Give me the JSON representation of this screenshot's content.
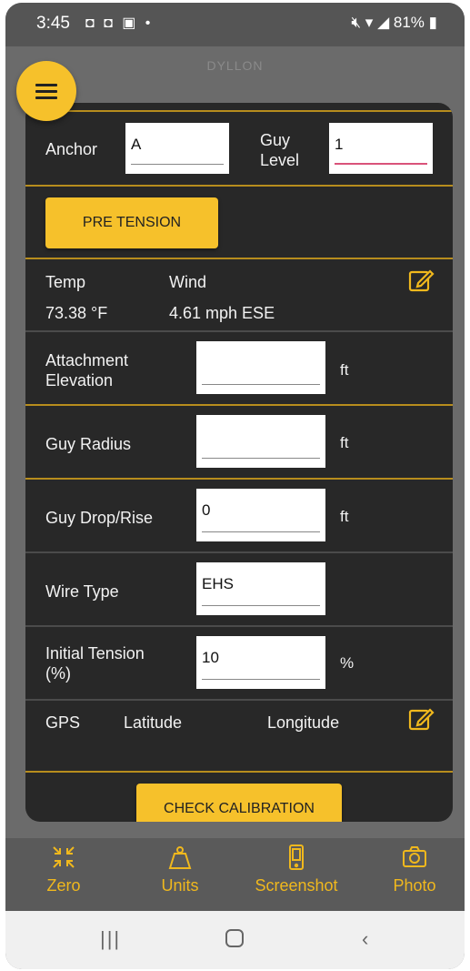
{
  "status_bar": {
    "time": "3:45",
    "notif_icons": "◘ ◘ ▣ •",
    "battery": "81%"
  },
  "app": {
    "title": "DYLLON"
  },
  "form": {
    "anchor_label": "Anchor",
    "anchor_value": "A",
    "guy_level_label_1": "Guy",
    "guy_level_label_2": "Level",
    "guy_level_value": "1",
    "pretension_button": "PRE TENSION",
    "temp_label": "Temp",
    "temp_value": "73.38 °F",
    "wind_label": "Wind",
    "wind_value": "4.61 mph  ESE",
    "attach_label_1": "Attachment",
    "attach_label_2": "Elevation",
    "attach_value": "",
    "attach_unit": "ft",
    "guy_radius_label": "Guy Radius",
    "guy_radius_value": "",
    "guy_radius_unit": "ft",
    "drop_label": "Guy Drop/Rise",
    "drop_value": "0",
    "drop_unit": "ft",
    "wire_label": "Wire Type",
    "wire_value": "EHS",
    "tension_label_1": "Initial Tension",
    "tension_label_2": "(%)",
    "tension_value": "10",
    "tension_unit": "%",
    "gps_label": "GPS",
    "latitude_label": "Latitude",
    "longitude_label": "Longitude",
    "check_calibration_button": "CHECK CALIBRATION"
  },
  "tabs": [
    {
      "label": "Zero",
      "icon": "zero-icon"
    },
    {
      "label": "Units",
      "icon": "weight-icon"
    },
    {
      "label": "Screenshot",
      "icon": "phone-screenshot-icon"
    },
    {
      "label": "Photo",
      "icon": "camera-icon"
    }
  ],
  "colors": {
    "accent": "#f6c12b",
    "panel": "#282828",
    "separator": "#b78d1d"
  }
}
